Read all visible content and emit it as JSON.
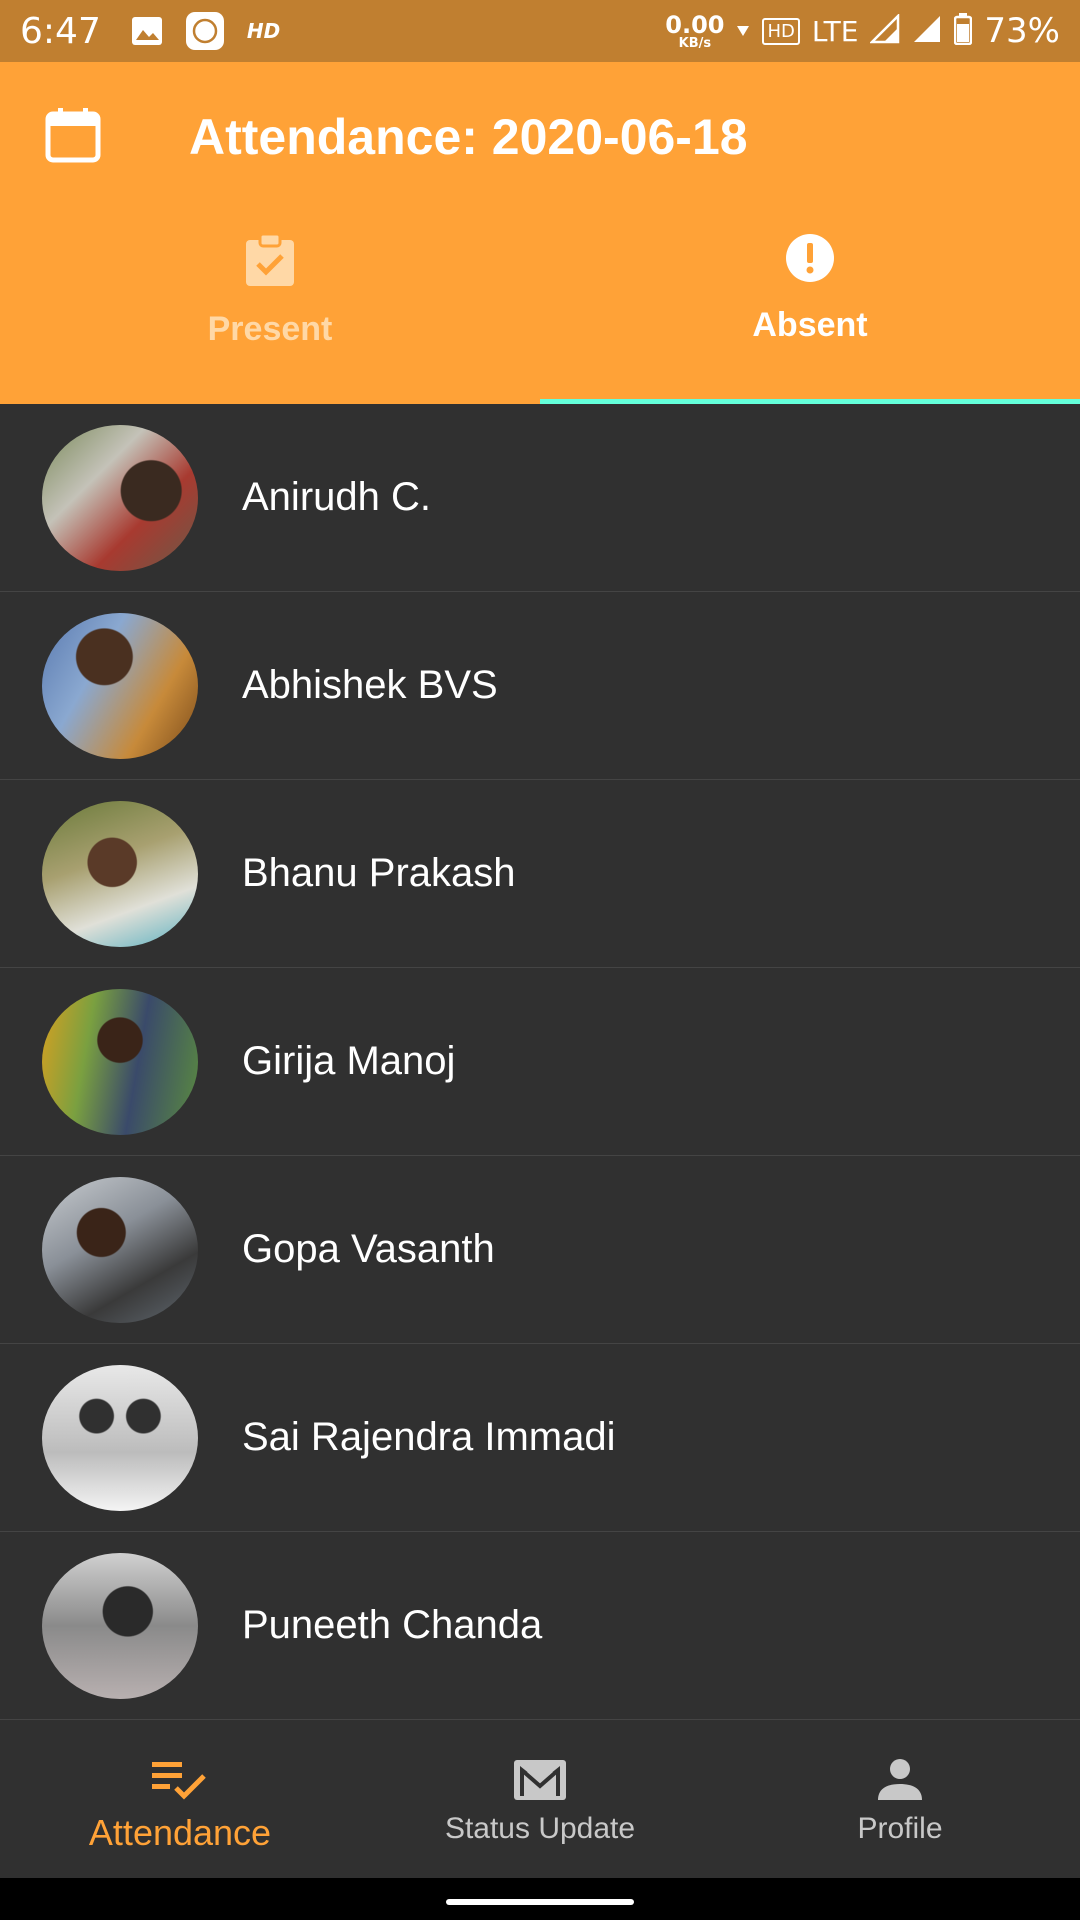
{
  "status_bar": {
    "time": "6:47",
    "hd_label": "HD",
    "net_speed": "0.00",
    "net_unit": "KB/s",
    "hd_box": "HD",
    "network": "LTE",
    "battery": "73%"
  },
  "header": {
    "title": "Attendance: 2020-06-18"
  },
  "tabs": [
    {
      "label": "Present",
      "icon": "clipboard-check-icon",
      "selected": false
    },
    {
      "label": "Absent",
      "icon": "alert-circle-icon",
      "selected": true
    }
  ],
  "students": [
    {
      "name": "Anirudh C."
    },
    {
      "name": "Abhishek BVS"
    },
    {
      "name": "Bhanu Prakash"
    },
    {
      "name": "Girija Manoj"
    },
    {
      "name": "Gopa Vasanth"
    },
    {
      "name": "Sai Rajendra Immadi"
    },
    {
      "name": "Puneeth Chanda"
    }
  ],
  "bottom_nav": [
    {
      "label": "Attendance",
      "icon": "checklist-icon",
      "active": true
    },
    {
      "label": "Status Update",
      "icon": "mail-icon",
      "active": false
    },
    {
      "label": "Profile",
      "icon": "person-icon",
      "active": false
    }
  ],
  "colors": {
    "primary": "#ffa237",
    "status_bar": "#c07f30",
    "background": "#303030",
    "tab_indicator": "#64ffda"
  }
}
